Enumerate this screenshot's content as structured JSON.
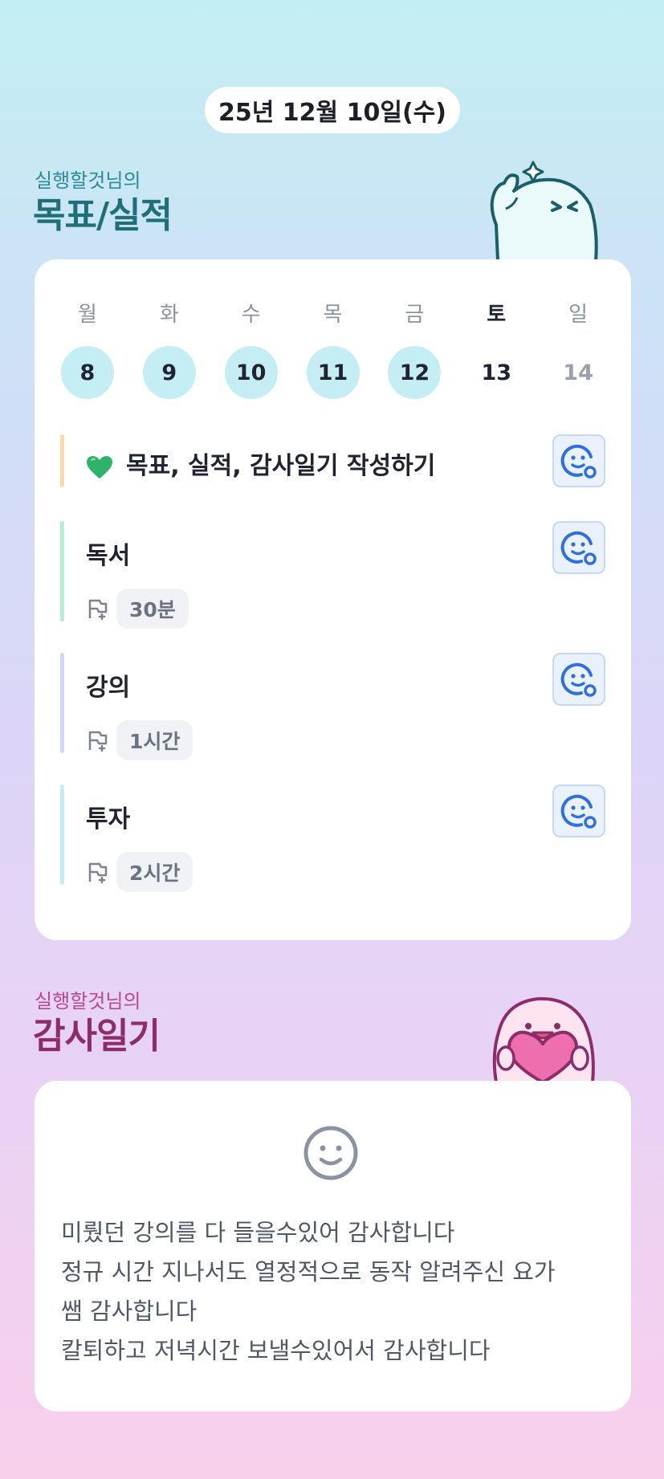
{
  "header": {
    "date": "25년 12월 10일(수)"
  },
  "goals_section": {
    "subtitle": "실행할것님의",
    "title": "목표/실적"
  },
  "week": {
    "days": [
      {
        "label": "월",
        "date": "8",
        "done": true
      },
      {
        "label": "화",
        "date": "9",
        "done": true
      },
      {
        "label": "수",
        "date": "10",
        "done": true
      },
      {
        "label": "목",
        "date": "11",
        "done": true
      },
      {
        "label": "금",
        "date": "12",
        "done": true
      },
      {
        "label": "토",
        "date": "13",
        "done": false
      },
      {
        "label": "일",
        "date": "14",
        "done": false
      }
    ]
  },
  "tasks": [
    {
      "name": "목표, 실적, 감사일기 작성하기",
      "icon": "green-heart-icon",
      "bar_color": "#fcd9ad"
    },
    {
      "name": "독서",
      "duration": "30분",
      "bar_color": "#b9ecd0"
    },
    {
      "name": "강의",
      "duration": "1시간",
      "bar_color": "#cfd8f8"
    },
    {
      "name": "투자",
      "duration": "2시간",
      "bar_color": "#c4ecf3"
    }
  ],
  "gratitude_section": {
    "subtitle": "실행할것님의",
    "title": "감사일기",
    "lines": [
      "미뤘던 강의를 다 들을수있어 감사합니다",
      "정규 시간 지나서도 열정적으로 동작 알려주신 요가",
      "쌤 감사합니다",
      "칼퇴하고 저녁시간 보낼수있어서 감사합니다"
    ]
  },
  "colors": {
    "accent_teal": "#1e6f78",
    "accent_magenta": "#8c2c6b",
    "date_circle": "#c4eef3",
    "emoji_blue": "#2f6fe0"
  }
}
